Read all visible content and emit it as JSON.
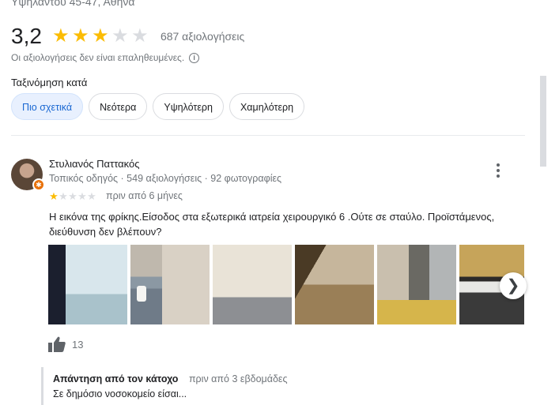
{
  "place": {
    "address": "Υψηλάντου 45-47, Αθήνα"
  },
  "rating": {
    "value": "3,2",
    "stars_filled": 3,
    "stars_total": 5,
    "count_text": "687 αξιολογήσεις",
    "unverified_text": "Οι αξιολογήσεις δεν είναι επαληθευμένες."
  },
  "sort": {
    "label": "Ταξινόμηση κατά",
    "options": [
      "Πιο σχετικά",
      "Νεότερα",
      "Υψηλότερη",
      "Χαμηλότερη"
    ],
    "selected": "Πιο σχετικά"
  },
  "review": {
    "reviewer_name": "Στυλιανός Παττακός",
    "reviewer_meta": "Τοπικός οδηγός · 549 αξιολογήσεις · 92 φωτογραφίες",
    "stars_filled": 1,
    "stars_total": 5,
    "date": "πριν από 6 μήνες",
    "text": "Η εικόνα της φρίκης.Είσοδος στα εξωτερικά ιατρεία χειρουργικό 6 .Ούτε σε σταύλο. Προϊστάμενος, διεύθυνση δεν βλέπουν?",
    "likes": "13"
  },
  "reply": {
    "owner_label": "Απάντηση από τον κάτοχο",
    "date": "πριν από 3 εβδομάδες",
    "text": "Σε δημόσιο νοσοκομείο είσαι..."
  },
  "colors": {
    "star_on": "#fbbc04",
    "star_off": "#dadce0",
    "chip_selected_bg": "#e8f0fe",
    "chip_selected_text": "#1967d2",
    "muted_text": "#70757a"
  }
}
